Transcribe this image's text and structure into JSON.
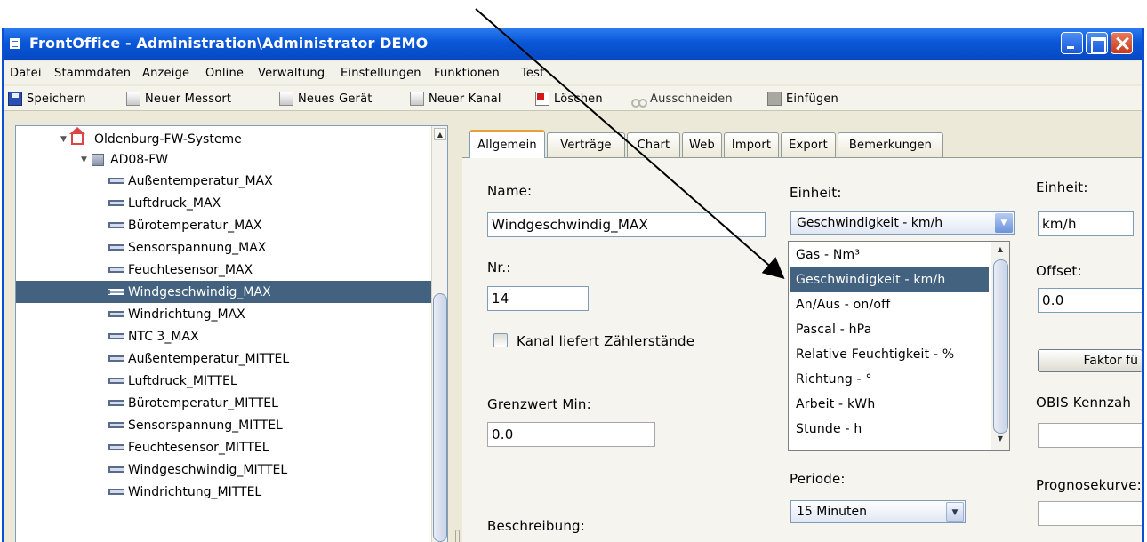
{
  "window": {
    "title": "FrontOffice - Administration\\Administrator DEMO"
  },
  "menubar": [
    "Datei",
    "Stammdaten",
    "Anzeige",
    "Online",
    "Verwaltung",
    "Einstellungen",
    "Funktionen",
    "Test"
  ],
  "toolbar": {
    "save": "Speichern",
    "new_location": "Neuer Messort",
    "new_device": "Neues Gerät",
    "new_channel": "Neuer Kanal",
    "delete": "Löschen",
    "cut": "Ausschneiden",
    "paste": "Einfügen"
  },
  "tree": {
    "root": "Oldenburg-FW-Systeme",
    "device": "AD08-FW",
    "channels": [
      "Außentemperatur_MAX",
      "Luftdruck_MAX",
      "Bürotemperatur_MAX",
      "Sensorspannung_MAX",
      "Feuchtesensor_MAX",
      "Windgeschwindig_MAX",
      "Windrichtung_MAX",
      "NTC 3_MAX",
      "Außentemperatur_MITTEL",
      "Luftdruck_MITTEL",
      "Bürotemperatur_MITTEL",
      "Sensorspannung_MITTEL",
      "Feuchtesensor_MITTEL",
      "Windgeschwindig_MITTEL",
      "Windrichtung_MITTEL"
    ],
    "selected_channel": "Windgeschwindig_MAX"
  },
  "tabs": [
    "Allgemein",
    "Verträge",
    "Chart",
    "Web",
    "Import",
    "Export",
    "Bemerkungen"
  ],
  "active_tab": "Allgemein",
  "form": {
    "name_label": "Name:",
    "name_value": "Windgeschwindig_MAX",
    "nr_label": "Nr.:",
    "nr_value": "14",
    "counter_checkbox_label": "Kanal liefert Zählerstände",
    "counter_checked": false,
    "limit_min_label": "Grenzwert Min:",
    "limit_min_value": "0.0",
    "description_label": "Beschreibung:",
    "unit_label": "Einheit:",
    "unit_selected": "Geschwindigkeit - km/h",
    "period_label": "Periode:",
    "period_value": "15 Minuten",
    "unit2_label": "Einheit:",
    "unit2_value": "km/h",
    "offset_label": "Offset:",
    "offset_value": "0.0",
    "factor_button": "Faktor fü",
    "obis_label": "OBIS Kennzah",
    "obis_value": "",
    "forecast_label": "Prognosekurve:",
    "forecast_value": ""
  },
  "unit_dropdown": {
    "options": [
      "Gas - Nm³",
      "Geschwindigkeit - km/h",
      "An/Aus - on/off",
      "Pascal - hPa",
      "Relative Feuchtigkeit - %",
      "Richtung - °",
      "Arbeit - kWh",
      "Stunde - h"
    ],
    "selected": "Geschwindigkeit - km/h"
  },
  "colors": {
    "titlebar": "#0a57d8",
    "selection": "#43627f",
    "active_tab_accent": "#e6a03a"
  }
}
